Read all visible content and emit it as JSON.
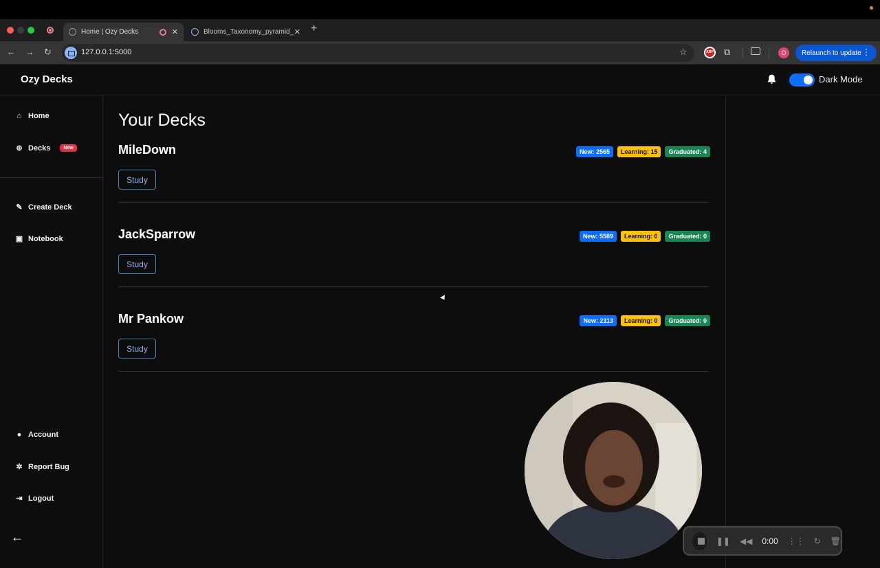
{
  "browser": {
    "tabs": [
      {
        "label": "Home | Ozy Decks",
        "close": "✕"
      },
      {
        "label": "Blooms_Taxonomy_pyramid_",
        "close": "✕"
      }
    ],
    "new_tab": "+",
    "url": "127.0.0.1:5000",
    "relaunch_label": "Relaunch to update",
    "profile_initial": "O",
    "ext_abp": "ABP"
  },
  "header": {
    "brand": "Ozy Decks",
    "dark_mode_label": "Dark Mode",
    "dark_mode_on": true
  },
  "sidebar": {
    "items": [
      {
        "label": "Home",
        "icon": "home-icon"
      },
      {
        "label": "Decks",
        "icon": "plus-circle-icon",
        "badge": "New"
      },
      {
        "label": "Create Deck",
        "icon": "pencil-icon"
      },
      {
        "label": "Notebook",
        "icon": "book-icon"
      },
      {
        "label": "Account",
        "icon": "user-icon"
      },
      {
        "label": "Report Bug",
        "icon": "bug-icon"
      },
      {
        "label": "Logout",
        "icon": "logout-icon"
      }
    ],
    "collapse_icon": "←"
  },
  "main": {
    "title": "Your Decks",
    "decks": [
      {
        "name": "MileDown",
        "new": "New: 2565",
        "learning": "Learning: 15",
        "graduated": "Graduated: 4",
        "study": "Study"
      },
      {
        "name": "JackSparrow",
        "new": "New: 5589",
        "learning": "Learning: 0",
        "graduated": "Graduated: 0",
        "study": "Study"
      },
      {
        "name": "Mr Pankow",
        "new": "New: 2113",
        "learning": "Learning: 0",
        "graduated": "Graduated: 0",
        "study": "Study"
      }
    ]
  },
  "recorder": {
    "time": "0:00"
  },
  "colors": {
    "accent": "#0d6efd",
    "learning": "#ffc107",
    "graduated": "#198754",
    "danger": "#dc3545"
  }
}
